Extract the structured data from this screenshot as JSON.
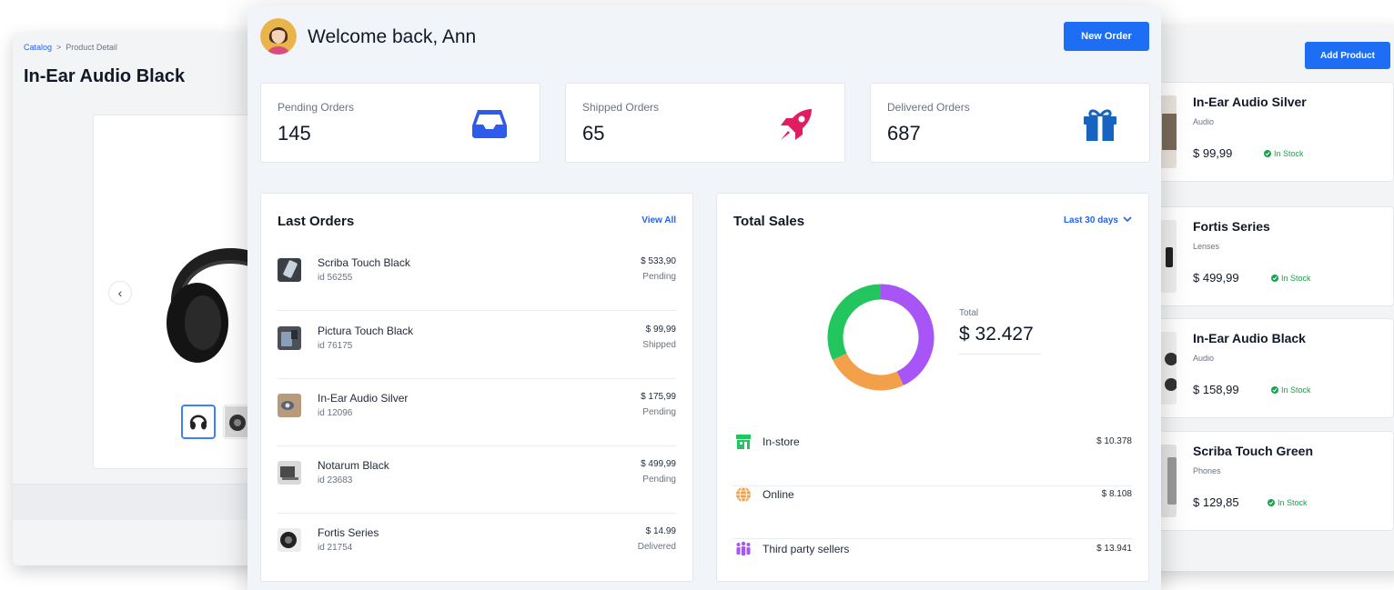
{
  "left_window": {
    "breadcrumb": {
      "link": "Catalog",
      "separator": ">",
      "current": "Product Detail"
    },
    "title": "In-Ear Audio Black",
    "prev_arrow": "‹"
  },
  "right_window": {
    "add_product_label": "Add Product",
    "products": [
      {
        "name": "In-Ear Audio Silver",
        "category": "Audio",
        "price": "$ 99,99",
        "stock": "In Stock"
      },
      {
        "name": "Fortis Series",
        "category": "Lenses",
        "price": "$ 499,99",
        "stock": "In Stock"
      },
      {
        "name": "In-Ear Audio Black",
        "category": "Audio",
        "price": "$ 158,99",
        "stock": "In Stock"
      },
      {
        "name": "Scriba Touch Green",
        "category": "Phones",
        "price": "$ 129,85",
        "stock": "In Stock"
      }
    ]
  },
  "main": {
    "welcome": "Welcome back, Ann",
    "new_order_label": "New Order",
    "stats": [
      {
        "label": "Pending Orders",
        "value": "145",
        "icon": "inbox-icon",
        "color": "#2f5bea"
      },
      {
        "label": "Shipped Orders",
        "value": "65",
        "icon": "rocket-icon",
        "color": "#e11d62"
      },
      {
        "label": "Delivered Orders",
        "value": "687",
        "icon": "gift-icon",
        "color": "#1664c0"
      }
    ],
    "last_orders": {
      "title": "Last Orders",
      "view_all": "View All",
      "rows": [
        {
          "name": "Scriba Touch Black",
          "id": "id 56255",
          "amount": "$ 533,90",
          "status": "Pending"
        },
        {
          "name": "Pictura Touch Black",
          "id": "id 76175",
          "amount": "$ 99,99",
          "status": "Shipped"
        },
        {
          "name": "In-Ear Audio Silver",
          "id": "id 12096",
          "amount": "$ 175,99",
          "status": "Pending"
        },
        {
          "name": "Notarum Black",
          "id": "id 23683",
          "amount": "$ 499,99",
          "status": "Pending"
        },
        {
          "name": "Fortis Series",
          "id": "id 21754",
          "amount": "$ 14.99",
          "status": "Delivered"
        }
      ]
    },
    "total_sales": {
      "title": "Total Sales",
      "period": "Last 30 days",
      "total_label": "Total",
      "total_value": "$ 32.427",
      "channels": [
        {
          "name": "In-store",
          "amount": "$ 10.378",
          "value": 10378,
          "color": "#22c55e",
          "icon": "store-icon"
        },
        {
          "name": "Online",
          "amount": "$ 8.108",
          "value": 8108,
          "color": "#f2a04a",
          "icon": "globe-icon"
        },
        {
          "name": "Third party sellers",
          "amount": "$ 13.941",
          "value": 13941,
          "color": "#a855f7",
          "icon": "people-icon"
        }
      ]
    }
  }
}
